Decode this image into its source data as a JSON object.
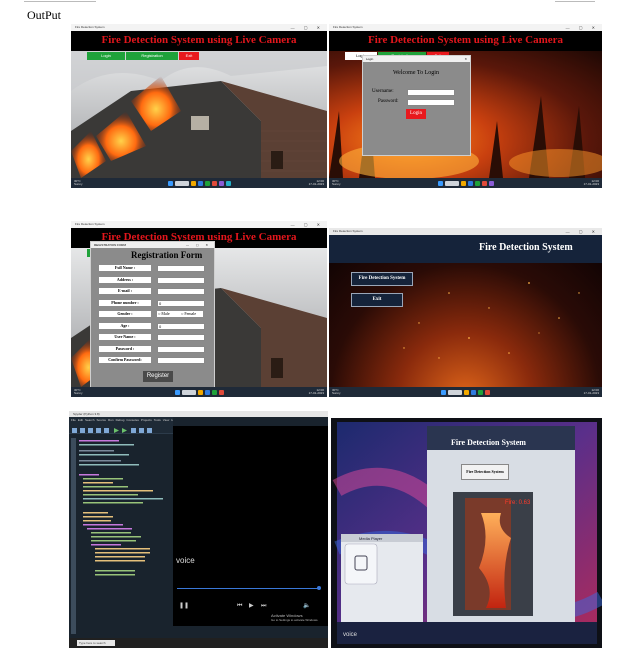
{
  "page": {
    "heading": "OutPut"
  },
  "app": {
    "title": "Fire Detection System using Live Camera",
    "nav": {
      "login": "Login",
      "registration": "Registration",
      "exit": "Exit"
    },
    "colors": {
      "title_red": "#e2161c",
      "login_green": "#1fa23a",
      "exit_red": "#e8191e"
    }
  },
  "panel1": {
    "window_title": "Fire Detection System"
  },
  "panel2": {
    "window_title": "Fire Detection System",
    "nav": {
      "login": "Login",
      "registration": "Registration",
      "exit": "Exit"
    },
    "dialog": {
      "title": "Login",
      "welcome": "Welcome To Login",
      "username_label": "Username:",
      "password_label": "Password:",
      "login_button": "Login"
    }
  },
  "panel3": {
    "dialog_title": "REGISTRATION FORM",
    "form_title": "Registration Form",
    "fields": [
      {
        "label": "Full Name :"
      },
      {
        "label": "Address :"
      },
      {
        "label": "E-mail :"
      },
      {
        "label": "Phone number :",
        "value": "0"
      },
      {
        "label": "Gender :"
      },
      {
        "label": "Age :",
        "value": "0"
      },
      {
        "label": "User Name :"
      },
      {
        "label": "Password :"
      },
      {
        "label": "Confirm Password:"
      }
    ],
    "gender_options": [
      "Male",
      "Female"
    ],
    "register_button": "Register"
  },
  "panel4": {
    "window_title": "Fire Detection System",
    "title": "Fire Detection System",
    "menu": [
      "Fire Detection System",
      "Exit"
    ]
  },
  "panel5": {
    "app_title": "Spyder (Python 3.8)",
    "menu": [
      "File",
      "Edit",
      "Search",
      "Source",
      "Run",
      "Debug",
      "Consoles",
      "Projects",
      "Tools",
      "View",
      "Help"
    ],
    "video_label": "voice",
    "activate": [
      "Activate Windows",
      "Go to Settings to activate Windows."
    ],
    "search_placeholder": "Type here to search"
  },
  "panel6": {
    "title": "Fire Detection System",
    "button": "Fire Detection System",
    "media_player_title": "Media Player",
    "fire_label": "Fire: 0.63",
    "voice_label": "voice"
  },
  "taskbar": {
    "weather": "30°C",
    "weather_sub": "Sunny",
    "time": "12:00",
    "date": "17-01-2023",
    "search": "Search"
  }
}
